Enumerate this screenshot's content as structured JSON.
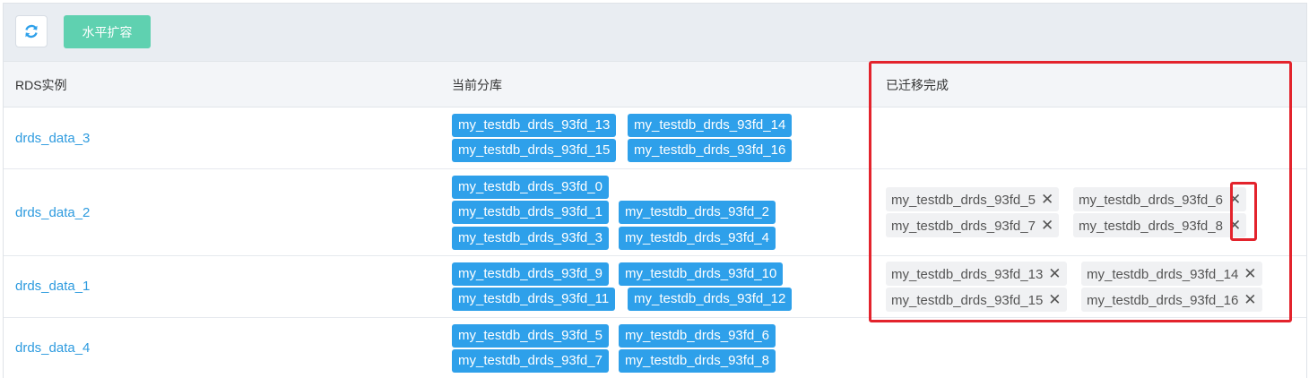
{
  "colors": {
    "accent": "#2ea0ea",
    "primary_button": "#5fd1b0",
    "link": "#2e9bdf",
    "highlight": "#e3232c"
  },
  "toolbar": {
    "refresh_icon": "refresh-icon",
    "scale_label": "水平扩容"
  },
  "table": {
    "headers": [
      "RDS实例",
      "当前分库",
      "已迁移完成"
    ],
    "rows": [
      {
        "instance": "drds_data_3",
        "shards": [
          "my_testdb_drds_93fd_13",
          "my_testdb_drds_93fd_14",
          "my_testdb_drds_93fd_15",
          "my_testdb_drds_93fd_16"
        ],
        "migrated": []
      },
      {
        "instance": "drds_data_2",
        "shards": [
          "my_testdb_drds_93fd_0",
          "my_testdb_drds_93fd_1",
          "my_testdb_drds_93fd_2",
          "my_testdb_drds_93fd_3",
          "my_testdb_drds_93fd_4"
        ],
        "migrated": [
          "my_testdb_drds_93fd_5",
          "my_testdb_drds_93fd_6",
          "my_testdb_drds_93fd_7",
          "my_testdb_drds_93fd_8"
        ]
      },
      {
        "instance": "drds_data_1",
        "shards": [
          "my_testdb_drds_93fd_9",
          "my_testdb_drds_93fd_10",
          "my_testdb_drds_93fd_11",
          "my_testdb_drds_93fd_12"
        ],
        "migrated": [
          "my_testdb_drds_93fd_13",
          "my_testdb_drds_93fd_14",
          "my_testdb_drds_93fd_15",
          "my_testdb_drds_93fd_16"
        ]
      },
      {
        "instance": "drds_data_4",
        "shards": [
          "my_testdb_drds_93fd_5",
          "my_testdb_drds_93fd_6",
          "my_testdb_drds_93fd_7",
          "my_testdb_drds_93fd_8"
        ],
        "migrated": []
      }
    ]
  },
  "remove_glyph": "✕"
}
